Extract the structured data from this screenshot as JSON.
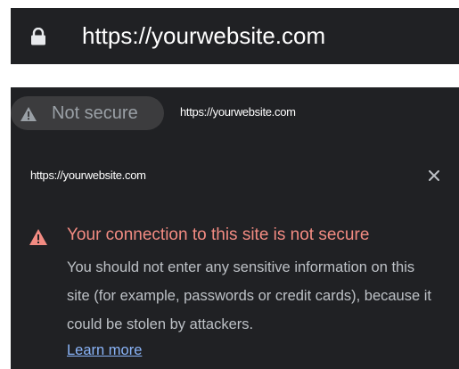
{
  "secure_bar": {
    "url": "https://yourwebsite.com",
    "icon": "lock-icon"
  },
  "insecure_panel": {
    "chip": {
      "label": "Not secure",
      "icon": "warning-icon"
    },
    "address_url": "https://yourwebsite.com",
    "popup": {
      "site_url": "https://yourwebsite.com",
      "close_icon": "close-icon",
      "warning_icon": "warning-icon",
      "title": "Your connection to this site is not secure",
      "body": "You should not enter any sensitive information on this site (for example, passwords or credit cards), because it could be stolen by attackers.",
      "learn_more": "Learn more"
    }
  },
  "colors": {
    "bar_background": "#202124",
    "chip_background": "#3c3c3e",
    "warning_red": "#f28b82",
    "link_blue": "#8ab4f8",
    "body_text": "#bdc1c6"
  }
}
